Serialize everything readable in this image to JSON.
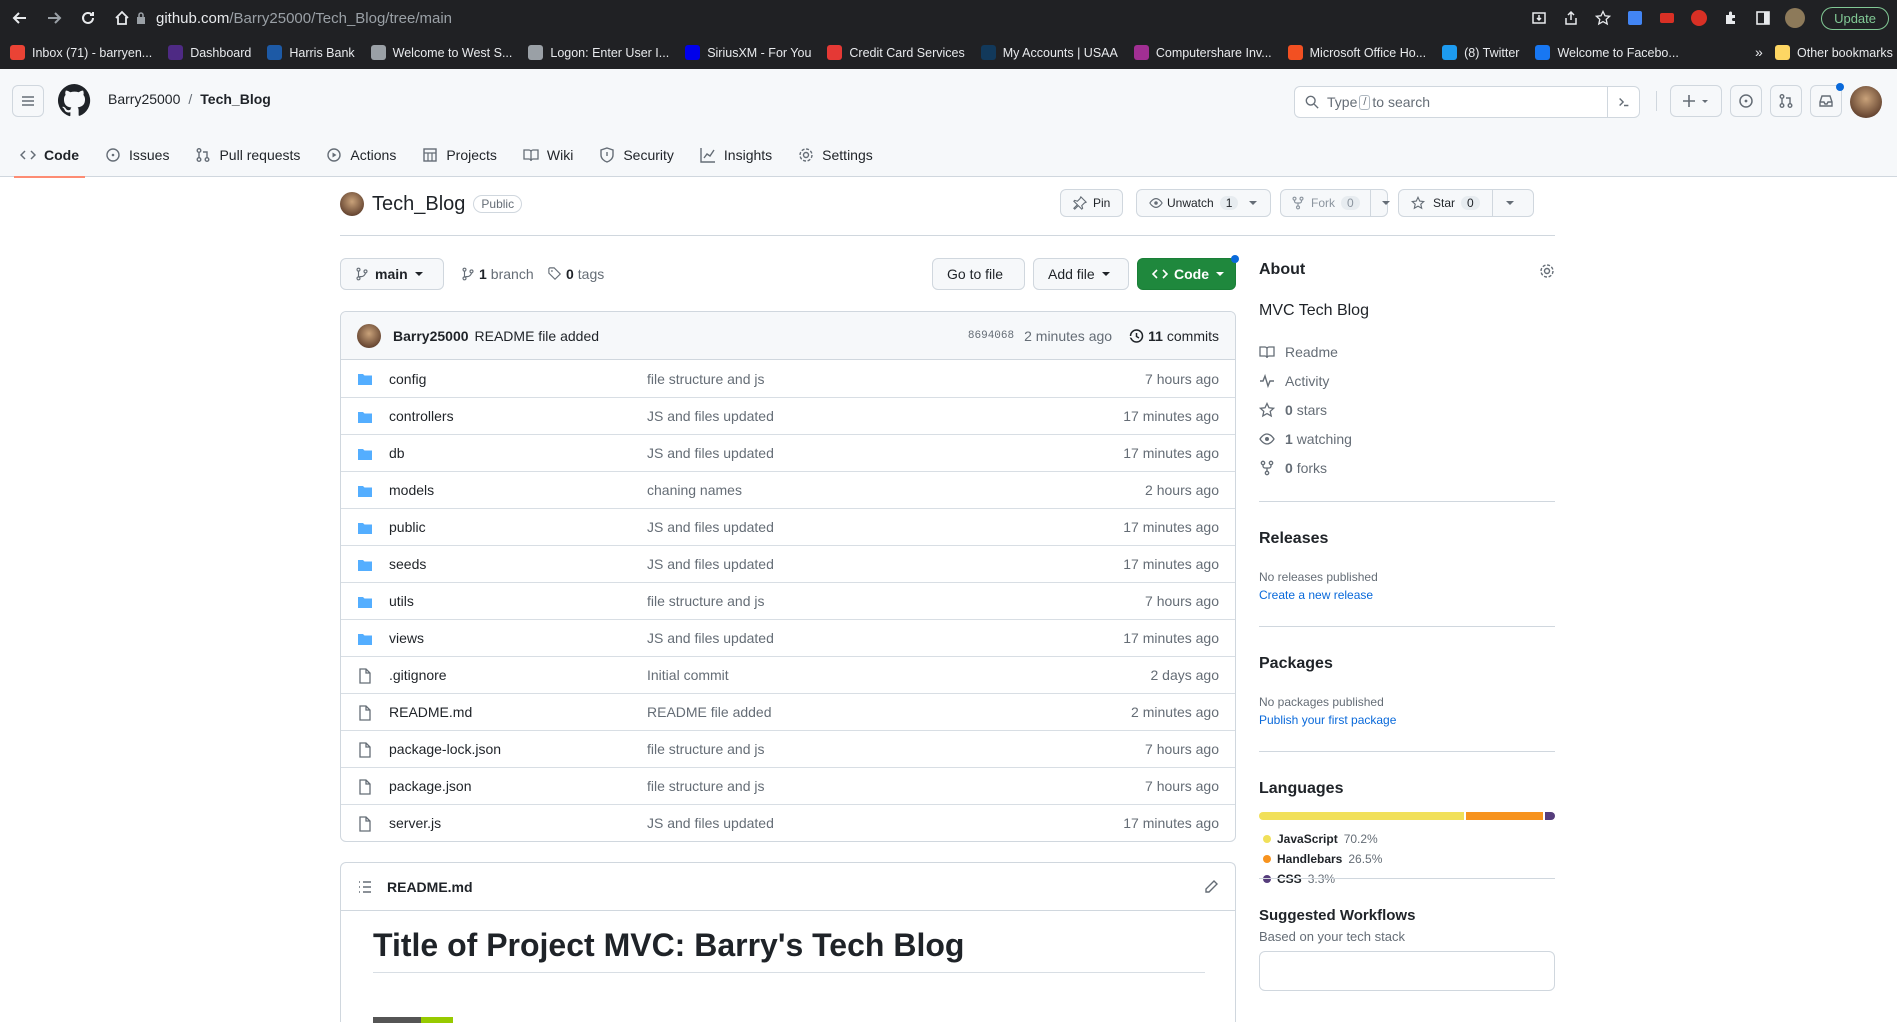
{
  "browser": {
    "url_host": "github.com",
    "url_path": "/Barry25000/Tech_Blog/tree/main",
    "update_label": "Update",
    "bookmarks": [
      {
        "label": "Inbox (71) - barryen...",
        "color": "#ea4335"
      },
      {
        "label": "Dashboard",
        "color": "#4e2a84"
      },
      {
        "label": "Harris Bank",
        "color": "#1d5aa6"
      },
      {
        "label": "Welcome to West S...",
        "color": "#9aa0a6"
      },
      {
        "label": "Logon: Enter User I...",
        "color": "#9aa0a6"
      },
      {
        "label": "SiriusXM - For You",
        "color": "#0000eb"
      },
      {
        "label": "Credit Card Services",
        "color": "#e53935"
      },
      {
        "label": "My Accounts | USAA",
        "color": "#12395b"
      },
      {
        "label": "Computershare Inv...",
        "color": "#a12f93"
      },
      {
        "label": "Microsoft Office Ho...",
        "color": "#f25022"
      },
      {
        "label": "(8) Twitter",
        "color": "#1d9bf0"
      },
      {
        "label": "Welcome to Facebo...",
        "color": "#1877f2"
      }
    ],
    "overflow": "»",
    "other_bookmarks": "Other bookmarks"
  },
  "header": {
    "owner": "Barry25000",
    "sep": "/",
    "repo": "Tech_Blog",
    "search_pre": "Type",
    "search_key": "/",
    "search_post": "to search"
  },
  "tabs": [
    {
      "label": "Code",
      "icon": "code-icon"
    },
    {
      "label": "Issues",
      "icon": "issue-icon"
    },
    {
      "label": "Pull requests",
      "icon": "pull-request-icon"
    },
    {
      "label": "Actions",
      "icon": "play-icon"
    },
    {
      "label": "Projects",
      "icon": "table-icon"
    },
    {
      "label": "Wiki",
      "icon": "book-icon"
    },
    {
      "label": "Security",
      "icon": "shield-icon"
    },
    {
      "label": "Insights",
      "icon": "graph-icon"
    },
    {
      "label": "Settings",
      "icon": "gear-icon"
    }
  ],
  "repo": {
    "name": "Tech_Blog",
    "visibility": "Public",
    "pin": "Pin",
    "unwatch": "Unwatch",
    "watch_count": "1",
    "fork": "Fork",
    "fork_count": "0",
    "star": "Star",
    "star_count": "0"
  },
  "toolbar": {
    "branch": "main",
    "branch_count": "1",
    "branch_label": "branch",
    "tag_count": "0",
    "tag_label": "tags",
    "goto": "Go to file",
    "add": "Add file",
    "code": "Code"
  },
  "commit": {
    "author": "Barry25000",
    "message": "README file added",
    "sha": "8694068",
    "time": "2 minutes ago",
    "count": "11",
    "count_label": "commits"
  },
  "files": [
    {
      "name": "config",
      "type": "dir",
      "msg": "file structure and js",
      "time": "7 hours ago"
    },
    {
      "name": "controllers",
      "type": "dir",
      "msg": "JS and files updated",
      "time": "17 minutes ago"
    },
    {
      "name": "db",
      "type": "dir",
      "msg": "JS and files updated",
      "time": "17 minutes ago"
    },
    {
      "name": "models",
      "type": "dir",
      "msg": "chaning names",
      "time": "2 hours ago"
    },
    {
      "name": "public",
      "type": "dir",
      "msg": "JS and files updated",
      "time": "17 minutes ago"
    },
    {
      "name": "seeds",
      "type": "dir",
      "msg": "JS and files updated",
      "time": "17 minutes ago"
    },
    {
      "name": "utils",
      "type": "dir",
      "msg": "file structure and js",
      "time": "7 hours ago"
    },
    {
      "name": "views",
      "type": "dir",
      "msg": "JS and files updated",
      "time": "17 minutes ago"
    },
    {
      "name": ".gitignore",
      "type": "file",
      "msg": "Initial commit",
      "time": "2 days ago"
    },
    {
      "name": "README.md",
      "type": "file",
      "msg": "README file added",
      "time": "2 minutes ago"
    },
    {
      "name": "package-lock.json",
      "type": "file",
      "msg": "file structure and js",
      "time": "7 hours ago"
    },
    {
      "name": "package.json",
      "type": "file",
      "msg": "file structure and js",
      "time": "7 hours ago"
    },
    {
      "name": "server.js",
      "type": "file",
      "msg": "JS and files updated",
      "time": "17 minutes ago"
    }
  ],
  "readme": {
    "filename": "README.md",
    "title": "Title of Project MVC: Barry's Tech Blog"
  },
  "about": {
    "heading": "About",
    "description": "MVC Tech Blog",
    "readme": "Readme",
    "activity": "Activity",
    "stars_count": "0",
    "stars": "stars",
    "watching_count": "1",
    "watching": "watching",
    "forks_count": "0",
    "forks": "forks"
  },
  "releases": {
    "heading": "Releases",
    "none": "No releases published",
    "link": "Create a new release"
  },
  "packages": {
    "heading": "Packages",
    "none": "No packages published",
    "link": "Publish your first package"
  },
  "languages": {
    "heading": "Languages",
    "items": [
      {
        "name": "JavaScript",
        "percent": "70.2%",
        "value": 70.2,
        "color": "#f1e05a"
      },
      {
        "name": "Handlebars",
        "percent": "26.5%",
        "value": 26.5,
        "color": "#f7931e"
      },
      {
        "name": "CSS",
        "percent": "3.3%",
        "value": 3.3,
        "color": "#563d7c"
      }
    ]
  },
  "workflows": {
    "heading": "Suggested Workflows",
    "sub": "Based on your tech stack"
  }
}
